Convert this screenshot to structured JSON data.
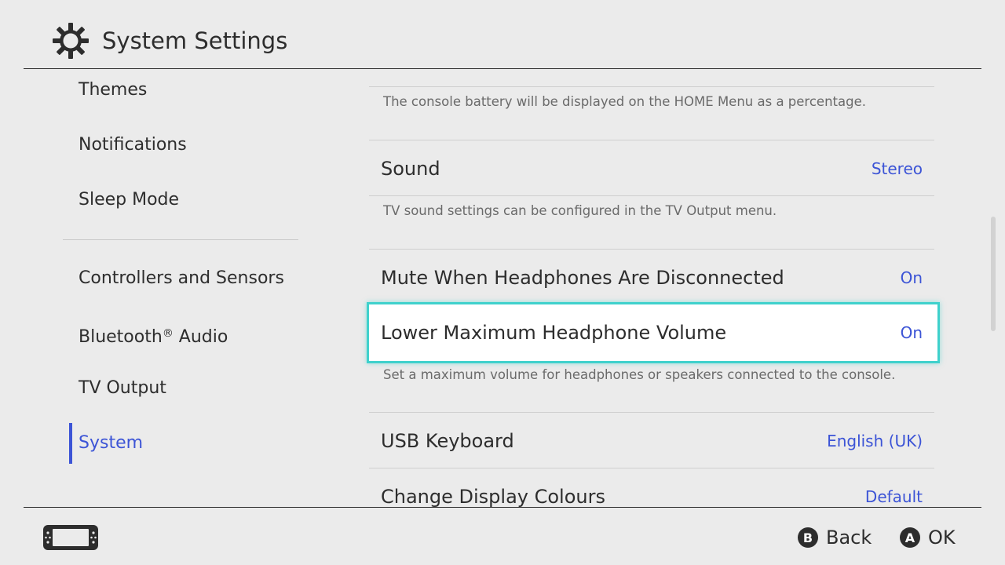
{
  "header": {
    "title": "System Settings",
    "icon": "gear-icon"
  },
  "sidebar": {
    "items": [
      {
        "label": "Themes"
      },
      {
        "label": "Notifications"
      },
      {
        "label": "Sleep Mode"
      },
      {
        "label": "Controllers and Sensors"
      },
      {
        "label": "Bluetooth",
        "trademark": "®",
        "suffix": " Audio"
      },
      {
        "label": "TV Output"
      },
      {
        "label": "System",
        "active": true
      }
    ]
  },
  "settings": {
    "battery_desc": "The console battery will be displayed on the HOME Menu as a percentage.",
    "sound": {
      "label": "Sound",
      "value": "Stereo",
      "desc": "TV sound settings can be configured in the TV Output menu."
    },
    "mute": {
      "label": "Mute When Headphones Are Disconnected",
      "value": "On"
    },
    "lower_volume": {
      "label": "Lower Maximum Headphone Volume",
      "value": "On",
      "desc": "Set a maximum volume for headphones or speakers connected to the console.",
      "selected": true
    },
    "usb_keyboard": {
      "label": "USB Keyboard",
      "value": "English (UK)"
    },
    "display_colours": {
      "label": "Change Display Colours",
      "value": "Default"
    }
  },
  "footer": {
    "device_icon": "handheld-console-icon",
    "back": {
      "button": "B",
      "label": "Back"
    },
    "ok": {
      "button": "A",
      "label": "OK"
    }
  },
  "colors": {
    "accent": "#3c54d6",
    "selection": "#3fd1cc",
    "background": "#ebebeb",
    "text": "#2d2d2d"
  }
}
